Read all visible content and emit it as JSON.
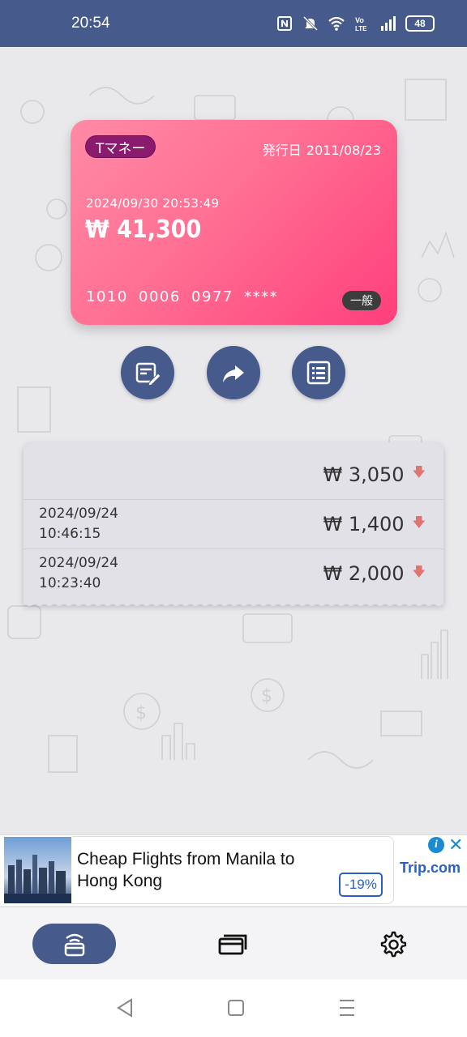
{
  "status_bar": {
    "time": "20:54",
    "battery": "48",
    "icons": [
      "nfc-icon",
      "mute-icon",
      "wifi-icon",
      "volte-icon",
      "signal-icon",
      "battery-icon"
    ]
  },
  "card": {
    "type_label": "Tマネー",
    "issue_label": "発行日",
    "issue_date": "2011/08/23",
    "datetime": "2024/09/30 20:53:49",
    "balance": "₩ 41,300",
    "number": "1010  0006  0977  ****",
    "grade": "一般",
    "colors": {
      "gradient_start": "#ff8aa6",
      "gradient_end": "#ff3f7c",
      "type_badge": "#8a1a6e"
    }
  },
  "actions": [
    {
      "icon": "edit-note-icon"
    },
    {
      "icon": "share-arrow-icon"
    },
    {
      "icon": "list-icon"
    }
  ],
  "history": {
    "rows": [
      {
        "date": "",
        "time": "",
        "amount": "₩ 3,050",
        "direction": "down"
      },
      {
        "date": "2024/09/24",
        "time": "10:46:15",
        "amount": "₩ 1,400",
        "direction": "down"
      },
      {
        "date": "2024/09/24",
        "time": "10:23:40",
        "amount": "₩ 2,000",
        "direction": "down"
      }
    ]
  },
  "ad": {
    "title": "Cheap Flights from Manila to Hong Kong",
    "badge": "-19%",
    "brand": "Trip.com"
  },
  "bottom_nav": {
    "items": [
      {
        "icon": "card-reader-icon",
        "active": true
      },
      {
        "icon": "cards-stack-icon",
        "active": false
      },
      {
        "icon": "gear-icon",
        "active": false
      }
    ]
  },
  "accent_color": "#465a8c"
}
